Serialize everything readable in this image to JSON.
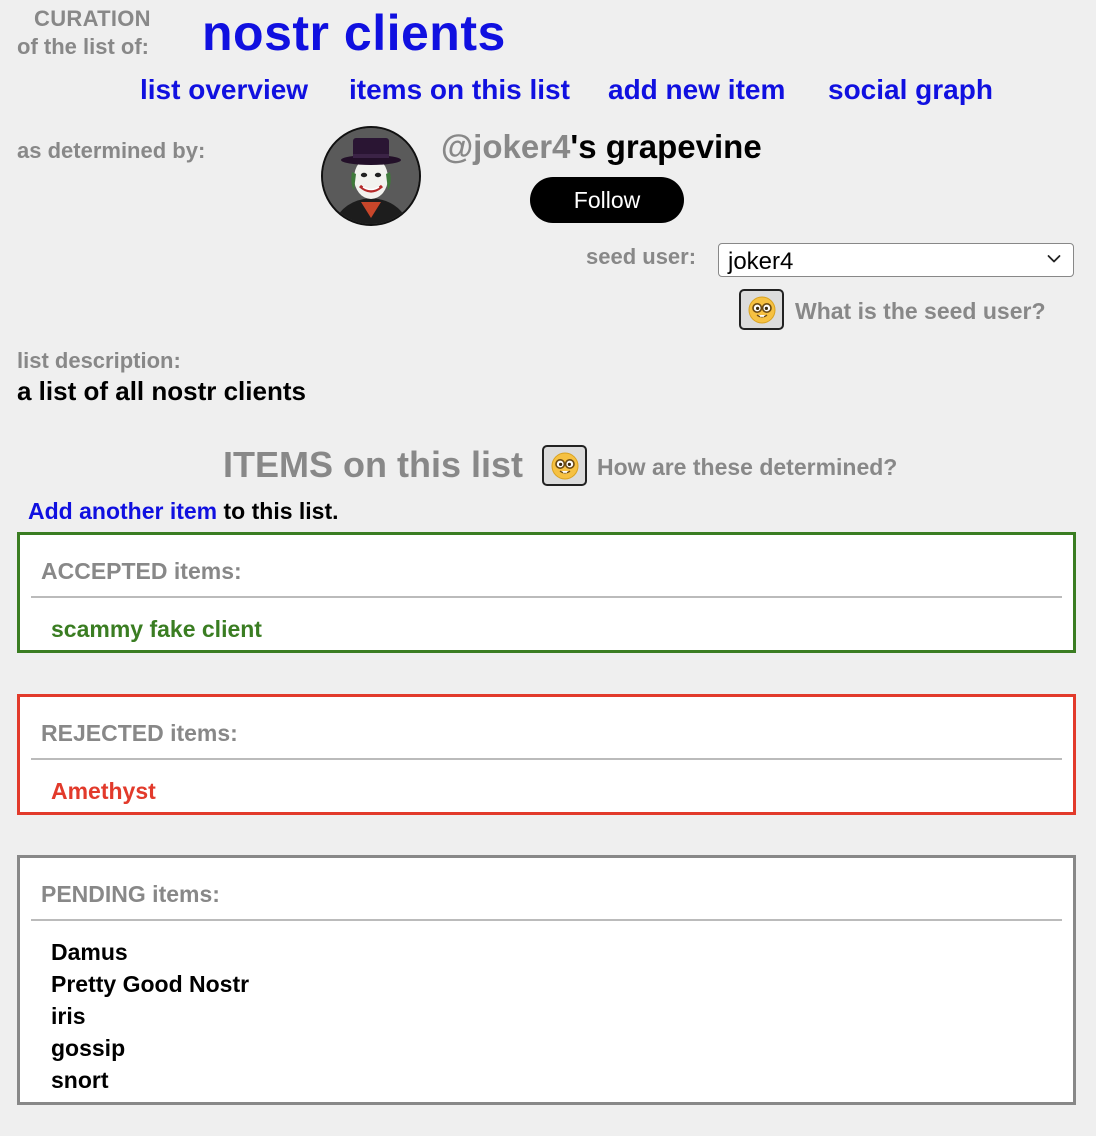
{
  "header": {
    "curation_label": "CURATION",
    "of_list_label": "of the list of:",
    "list_title": "nostr clients"
  },
  "nav": [
    {
      "label": "list overview"
    },
    {
      "label": "items on this list"
    },
    {
      "label": "add new item"
    },
    {
      "label": "social graph"
    }
  ],
  "determined": {
    "label": "as determined by:",
    "handle": "@joker4",
    "suffix": "'s grapevine",
    "follow_label": "Follow"
  },
  "seed": {
    "label": "seed user:",
    "selected": "joker4",
    "help_text": "What is the seed user?",
    "help_icon": "nerd-face-emoji"
  },
  "description": {
    "label": "list description:",
    "text": "a list of  all nostr clients"
  },
  "items_section": {
    "heading": "ITEMS on this list",
    "help_text": "How are these determined?",
    "help_icon": "nerd-face-emoji",
    "add_link": "Add another item",
    "add_suffix": " to this list."
  },
  "accepted": {
    "label": "ACCEPTED items:",
    "items": [
      "scammy fake client"
    ],
    "color": "#3a7d22"
  },
  "rejected": {
    "label": "REJECTED items:",
    "items": [
      "Amethyst"
    ],
    "color": "#e23a2b"
  },
  "pending": {
    "label": "PENDING items:",
    "items": [
      "Damus",
      "Pretty Good Nostr",
      "iris",
      "gossip",
      "snort"
    ],
    "color": "#888888"
  },
  "colors": {
    "link": "#1010e0",
    "muted": "#888888",
    "background": "#efefef"
  }
}
